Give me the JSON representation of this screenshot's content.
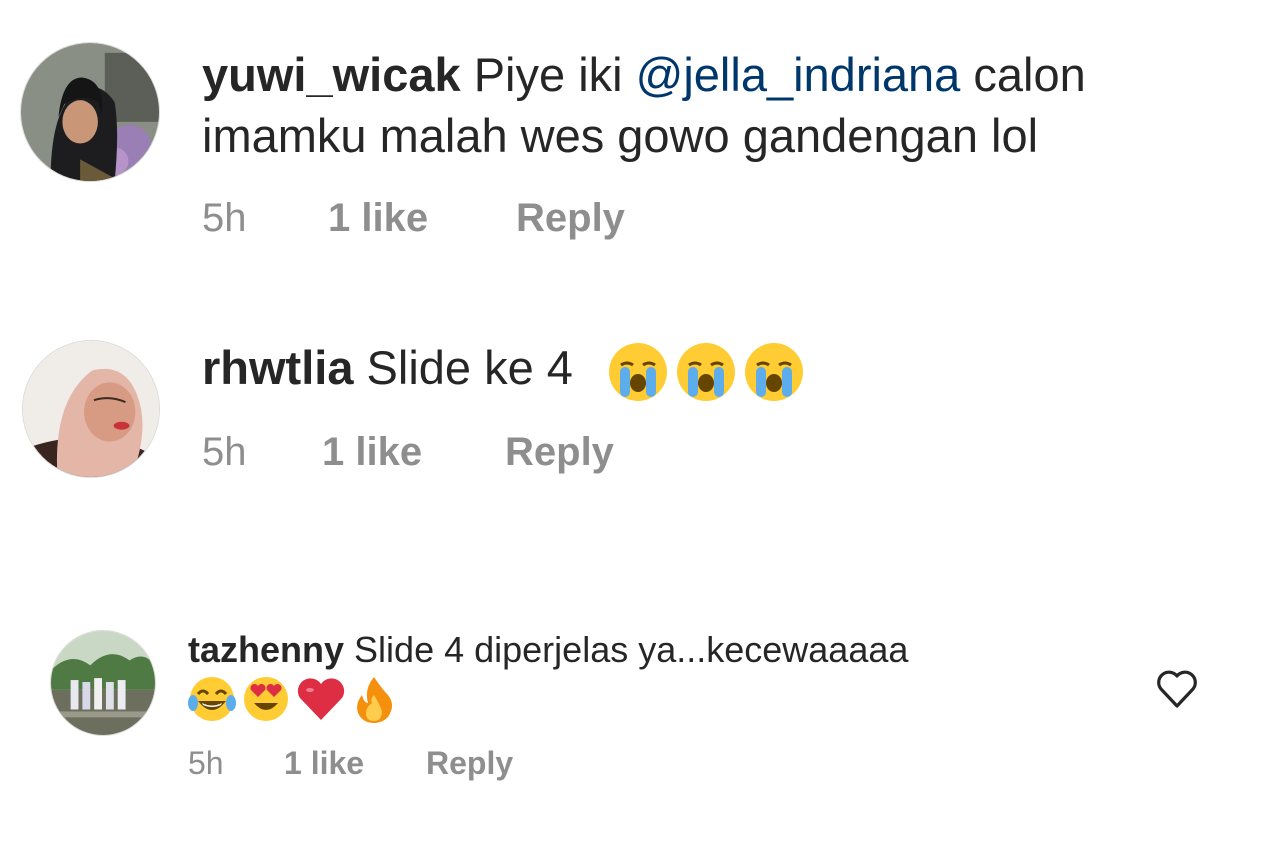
{
  "comments": [
    {
      "username": "yuwi_wicak",
      "text_before": "Piye iki ",
      "mention": "@jella_indriana",
      "text_after": " calon imamku malah wes gowo gandengan lol",
      "time": "5h",
      "likes": "1 like",
      "reply_label": "Reply",
      "emojis": []
    },
    {
      "username": "rhwtlia",
      "text": "Slide ke 4",
      "time": "5h",
      "likes": "1 like",
      "reply_label": "Reply",
      "emojis": [
        "loudly-crying-face",
        "loudly-crying-face",
        "loudly-crying-face"
      ]
    },
    {
      "username": "tazhenny",
      "text": "Slide 4 diperjelas ya...kecewaaaaa",
      "time": "5h",
      "likes": "1 like",
      "reply_label": "Reply",
      "emojis": [
        "face-with-tears-of-joy",
        "smiling-face-with-heart-eyes",
        "red-heart",
        "fire"
      ],
      "like_icon": "heart-outline-icon"
    }
  ],
  "colors": {
    "text": "#262626",
    "meta": "#8e8e8e",
    "mention": "#00376b"
  }
}
